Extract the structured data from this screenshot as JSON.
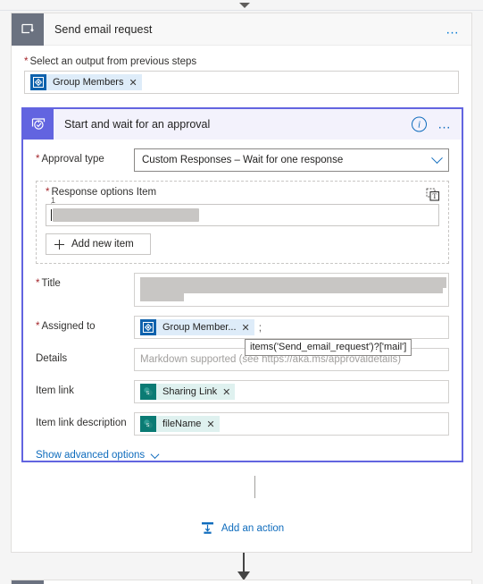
{
  "outer_card": {
    "icon": "apply-to-each-loop-icon",
    "title": "Send email request",
    "menu": "…",
    "field": {
      "required": "*",
      "label": "Select an output from previous steps",
      "token": {
        "icon": "azure-ad-icon",
        "label": "Group Members",
        "remove": "✕"
      }
    }
  },
  "approval_card": {
    "icon": "approval-check-icon",
    "title": "Start and wait for an approval",
    "info": "i",
    "menu": "…",
    "approval_type": {
      "required": "*",
      "label": "Approval type",
      "value": "Custom Responses – Wait for one response"
    },
    "response_options": {
      "required": "*",
      "label": "Response options Item",
      "text_mode_icon": "switch-to-text-mode-icon",
      "item_index": "1",
      "item_value_redacted": true,
      "add_new_item": "Add new item"
    },
    "title_field": {
      "required": "*",
      "label": "Title",
      "value_redacted": true
    },
    "assigned_to": {
      "required": "*",
      "label": "Assigned to",
      "token": {
        "icon": "azure-ad-icon",
        "label": "Group Member...",
        "remove": "✕"
      },
      "separator": ";"
    },
    "details": {
      "label": "Details",
      "placeholder": "Markdown supported (see https://aka.ms/approvaldetails)",
      "tooltip": "items('Send_email_request')?['mail']"
    },
    "item_link": {
      "label": "Item link",
      "token": {
        "icon": "sharepoint-icon",
        "label": "Sharing Link",
        "remove": "✕"
      }
    },
    "item_link_description": {
      "label": "Item link description",
      "token": {
        "icon": "sharepoint-icon",
        "label": "fileName",
        "remove": "✕"
      }
    },
    "show_advanced": "Show advanced options"
  },
  "add_action": {
    "icon": "insert-action-icon",
    "label": "Add an action"
  },
  "colors": {
    "accent_blue": "#0f6cbd",
    "approval_purple": "#6264e0",
    "required_red": "#a4262c",
    "loop_grey": "#6b7280",
    "sharepoint_teal": "#0b7b74",
    "aad_blue": "#0f62ad"
  }
}
